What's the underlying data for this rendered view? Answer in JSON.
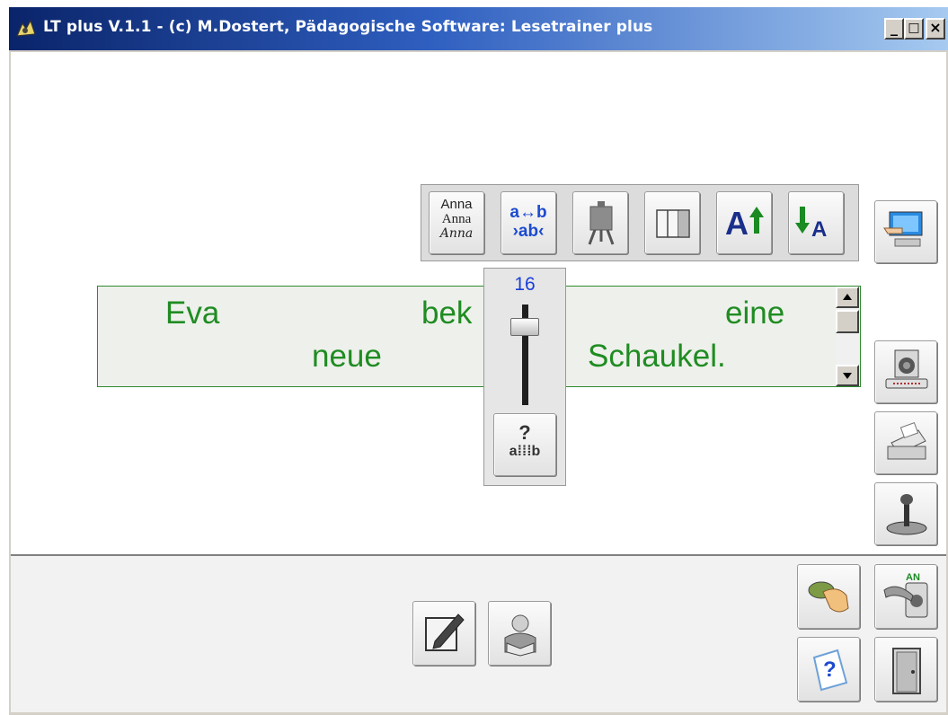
{
  "window": {
    "title": "LT plus   V.1.1 - (c) M.Dostert, Pädagogische Software: Lesetrainer plus",
    "controls": {
      "minimize": "_",
      "maximize": "□",
      "close": "×"
    }
  },
  "toolbar": {
    "font_sample": [
      "Anna",
      "Anna",
      "Anna"
    ],
    "spacing_sample_top": "a↔b",
    "spacing_sample_bottom": "›ab‹",
    "grow_letter": "A",
    "shrink_letter": "A"
  },
  "reading_text": {
    "line1": [
      "Eva",
      "bek",
      "eine"
    ],
    "line2": [
      "neue",
      "Schaukel."
    ]
  },
  "font_size_slider": {
    "value": "16",
    "help_question": "?",
    "help_sample": "a⁞⁞⁞b"
  },
  "side_buttons": {
    "on_switch_label": "AN",
    "help_mark": "?"
  },
  "icons": [
    "app-icon",
    "font-style-icon",
    "letter-spacing-icon",
    "easel-icon",
    "columns-icon",
    "font-larger-icon",
    "font-smaller-icon",
    "computer-hand-icon",
    "speaker-icon",
    "printer-icon",
    "joystick-icon",
    "mouse-hand-icon",
    "switch-on-icon",
    "help-icon",
    "exit-door-icon",
    "edit-icon",
    "reader-icon",
    "letter-spacing-help-icon"
  ],
  "colors": {
    "title_bar": "#0a246a",
    "reading_text": "#1f8c22",
    "slider_value": "#1a3fd8",
    "text_box_border": "#2e8b2e"
  }
}
